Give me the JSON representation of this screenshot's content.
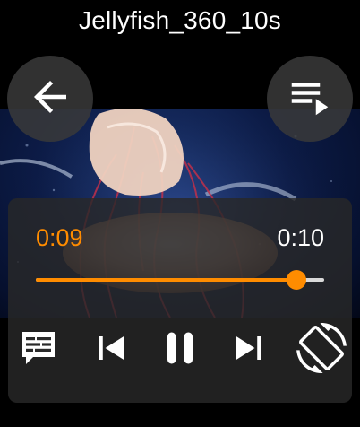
{
  "player": {
    "title": "Jellyfish_360_10s",
    "current_time": "0:09",
    "total_time": "0:10",
    "progress_fraction": 0.905
  },
  "icons": {
    "back": "arrow-left-icon",
    "playlist": "playlist-play-icon",
    "subtitles": "subtitles-icon",
    "previous": "skip-previous-icon",
    "pause": "pause-icon",
    "next": "skip-next-icon",
    "rotate": "screen-rotation-icon"
  },
  "colors": {
    "accent": "#ff8c00",
    "panel": "#282828",
    "icon": "#ffffff"
  }
}
